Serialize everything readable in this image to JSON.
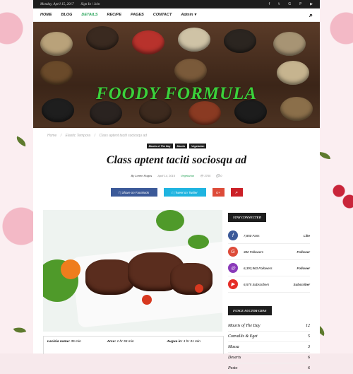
{
  "topbar": {
    "date": "Monday, April 15, 2017",
    "signin": "Sign In / Join"
  },
  "social_icons": [
    "facebook-icon",
    "twitter-icon",
    "gplus-icon",
    "pinterest-icon",
    "youtube-icon"
  ],
  "nav": {
    "items": [
      "HOME",
      "BLOG",
      "DETAILS",
      "RECIPE",
      "PAGES",
      "CONTACT",
      "Admin ▾"
    ],
    "active_index": 2
  },
  "site_title": "FOODY FORMULA",
  "breadcrumb": [
    "Home",
    "/",
    "Elastic Tempora",
    "/",
    "Class aptent taciti sociosqu ad"
  ],
  "categories": [
    "Mauris of The Day",
    "Mauris",
    "Vegetarian"
  ],
  "post": {
    "title": "Class aptent taciti sociosqu ad",
    "author": "By Lorem Rugos",
    "date": "April 14, 2016",
    "category": "Vegetarian",
    "views": "👁 3765",
    "comments": "💬 0"
  },
  "share": {
    "facebook": "f | Share on Facebook",
    "twitter": "t | Tweet on Twitter",
    "gplus": "G+",
    "pinterest": "P"
  },
  "caption": [
    {
      "label": "Lacinia name:",
      "value": " 35 min"
    },
    {
      "label": "Arcu:",
      "value": " 1 hr 55 min"
    },
    {
      "label": "Augue in:",
      "value": " 1 hr 31 min"
    }
  ],
  "sidebar": {
    "stay_title": "Stay Connected",
    "social": [
      {
        "icon": "f",
        "count": "7,850 Fans",
        "action": "Like",
        "color": "#3b5998"
      },
      {
        "icon": "G",
        "count": "382 Followers",
        "action": "Follower",
        "color": "#dd4b39"
      },
      {
        "icon": "◎",
        "count": "6,393,963 Followers",
        "action": "Follower",
        "color": "#8a3ab9"
      },
      {
        "icon": "▶",
        "count": "6,575 Subscribers",
        "action": "Subscriber",
        "color": "#e52d27"
      }
    ],
    "categories_title": "Fusce Auctor Cras",
    "categories": [
      {
        "name": "Mauris of The Day",
        "count": "12"
      },
      {
        "name": "Convallis & Eget",
        "count": "5"
      },
      {
        "name": "Massa",
        "count": "3"
      },
      {
        "name": "Deserts",
        "count": "6"
      },
      {
        "name": "Pesto",
        "count": "6"
      }
    ]
  }
}
